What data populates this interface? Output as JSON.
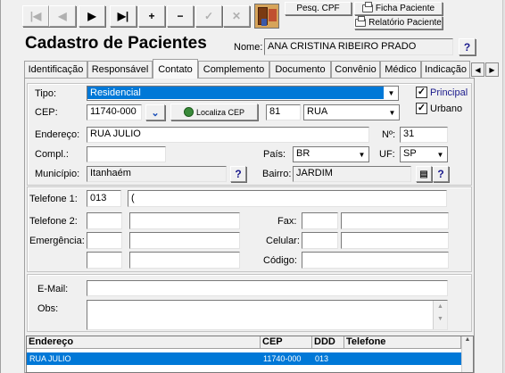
{
  "toolbar": {
    "buttons": [
      {
        "name": "first-record-button",
        "glyph": "|◀",
        "enabled": false
      },
      {
        "name": "prev-record-button",
        "glyph": "◀",
        "enabled": false
      },
      {
        "name": "next-record-button",
        "glyph": "▶",
        "enabled": true
      },
      {
        "name": "last-record-button",
        "glyph": "▶|",
        "enabled": true
      },
      {
        "name": "add-record-button",
        "glyph": "+",
        "enabled": true
      },
      {
        "name": "delete-record-button",
        "glyph": "−",
        "enabled": true
      },
      {
        "name": "confirm-button",
        "glyph": "✓",
        "enabled": false
      },
      {
        "name": "cancel-button",
        "glyph": "✕",
        "enabled": false
      }
    ],
    "pesq_cpf": "Pesq. CPF",
    "ficha_paciente": "Ficha Paciente",
    "relatorio_paciente": "Relatório Paciente"
  },
  "header": {
    "title": "Cadastro de Pacientes",
    "nome_label": "Nome:",
    "nome_value": "ANA CRISTINA RIBEIRO PRADO",
    "help": "?"
  },
  "tabs": [
    {
      "label": "Identificação"
    },
    {
      "label": "Responsável"
    },
    {
      "label": "Contato",
      "active": true
    },
    {
      "label": "Complemento"
    },
    {
      "label": "Documento"
    },
    {
      "label": "Convênio"
    },
    {
      "label": "Médico"
    },
    {
      "label": "Indicação"
    }
  ],
  "address": {
    "tipo_label": "Tipo:",
    "tipo_value": "Residencial",
    "principal_label": "Principal",
    "principal_checked": true,
    "urbano_label": "Urbano",
    "urbano_checked": true,
    "cep_label": "CEP:",
    "cep_value": "11740-000",
    "localiza_cep": "Localiza CEP",
    "logradouro_code": "81",
    "logradouro_tipo": "RUA",
    "endereco_label": "Endereço:",
    "endereco_value": "RUA JULIO",
    "numero_label": "Nº:",
    "numero_value": "31",
    "compl_label": "Compl.:",
    "compl_value": "",
    "pais_label": "País:",
    "pais_value": "BR",
    "uf_label": "UF:",
    "uf_value": "SP",
    "municipio_label": "Município:",
    "municipio_value": "Itanhaém",
    "bairro_label": "Bairro:",
    "bairro_value": "JARDIM"
  },
  "phones": {
    "telefone1_label": "Telefone 1:",
    "telefone1_ddd": "013",
    "telefone1_number": "(",
    "telefone2_label": "Telefone 2:",
    "fax_label": "Fax:",
    "emergencia_label": "Emergência:",
    "celular_label": "Celular:",
    "codigo_label": "Código:"
  },
  "contact": {
    "email_label": "E-Mail:",
    "email_value": "",
    "obs_label": "Obs:",
    "obs_value": ""
  },
  "table": {
    "columns": [
      "Endereço",
      "CEP",
      "DDD",
      "Telefone"
    ],
    "rows": [
      [
        "RUA JULIO",
        "11740-000",
        "013",
        ""
      ]
    ]
  }
}
